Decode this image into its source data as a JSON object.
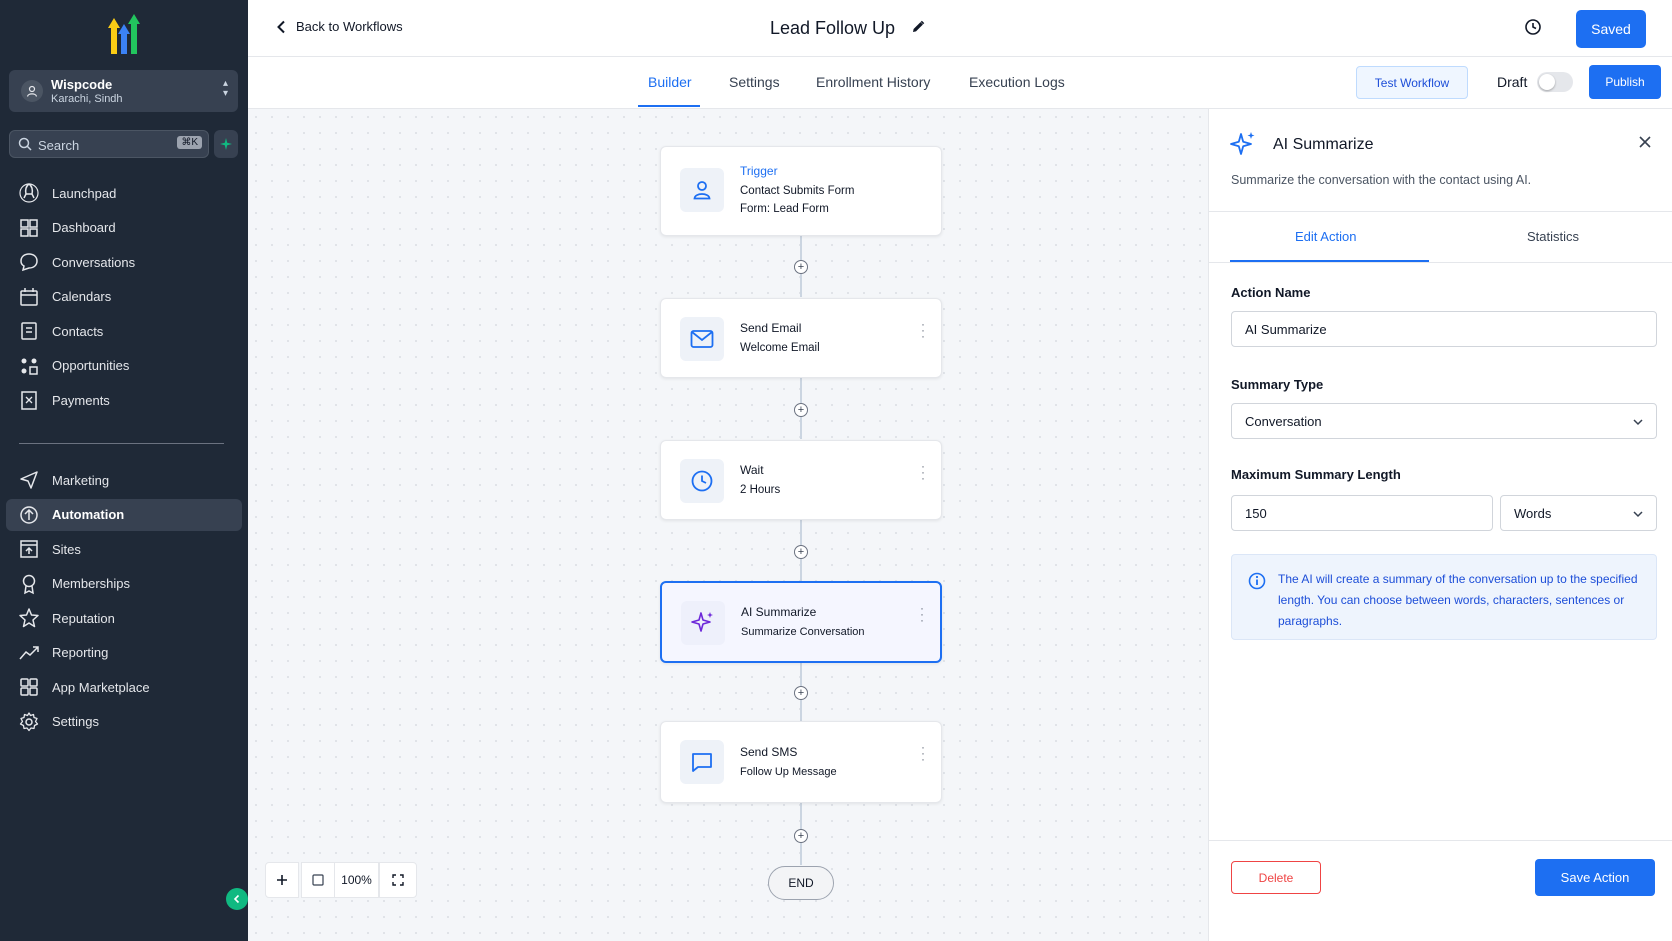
{
  "sidebar": {
    "account": {
      "name": "Wispcode",
      "location": "Karachi, Sindh"
    },
    "search": {
      "placeholder": "Search",
      "shortcut": "⌘K"
    },
    "items_top": [
      {
        "label": "Launchpad",
        "icon": "rocket-icon"
      },
      {
        "label": "Dashboard",
        "icon": "grid-icon"
      },
      {
        "label": "Conversations",
        "icon": "chat-icon"
      },
      {
        "label": "Calendars",
        "icon": "calendar-icon"
      },
      {
        "label": "Contacts",
        "icon": "contacts-icon"
      },
      {
        "label": "Opportunities",
        "icon": "opportunities-icon"
      },
      {
        "label": "Payments",
        "icon": "payments-icon"
      }
    ],
    "items_bottom": [
      {
        "label": "Marketing",
        "icon": "send-icon"
      },
      {
        "label": "Automation",
        "icon": "automation-icon",
        "active": true
      },
      {
        "label": "Sites",
        "icon": "sites-icon"
      },
      {
        "label": "Memberships",
        "icon": "badge-icon"
      },
      {
        "label": "Reputation",
        "icon": "star-icon"
      },
      {
        "label": "Reporting",
        "icon": "trend-icon"
      },
      {
        "label": "App Marketplace",
        "icon": "apps-icon"
      },
      {
        "label": "Settings",
        "icon": "gear-icon"
      }
    ]
  },
  "header": {
    "back_label": "Back to Workflows",
    "title": "Lead Follow Up",
    "saved_label": "Saved"
  },
  "tabs": {
    "items": [
      "Builder",
      "Settings",
      "Enrollment History",
      "Execution Logs"
    ],
    "active": "Builder",
    "test_label": "Test Workflow",
    "draft_label": "Draft",
    "publish_label": "Publish"
  },
  "workflow": {
    "trigger": {
      "kind": "Trigger",
      "title": "Contact Submits Form",
      "detail": "Form: Lead Form"
    },
    "steps": [
      {
        "title": "Send Email",
        "detail": "Welcome Email",
        "icon": "mail-icon"
      },
      {
        "title": "Wait",
        "detail": "2 Hours",
        "icon": "clock-icon"
      },
      {
        "title": "AI Summarize",
        "detail": "Summarize Conversation",
        "icon": "sparkle-icon",
        "selected": true
      },
      {
        "title": "Send SMS",
        "detail": "Follow Up Message",
        "icon": "message-icon"
      }
    ],
    "end_label": "END",
    "zoom": "100%"
  },
  "panel": {
    "title": "AI Summarize",
    "description": "Summarize the conversation with the contact using AI.",
    "tabs": [
      "Edit Action",
      "Statistics"
    ],
    "action_name_label": "Action Name",
    "action_name_value": "AI Summarize",
    "summary_type_label": "Summary Type",
    "summary_type_value": "Conversation",
    "max_length_label": "Maximum Summary Length",
    "max_length_value": "150",
    "max_length_unit": "Words",
    "info_text": "The AI will create a summary of the conversation up to the specified length. You can choose between words, characters, sentences or paragraphs.",
    "delete_label": "Delete",
    "save_label": "Save Action"
  },
  "colors": {
    "accent": "#1d6ff2",
    "sidebar": "#1f2937",
    "danger": "#ef4444"
  }
}
